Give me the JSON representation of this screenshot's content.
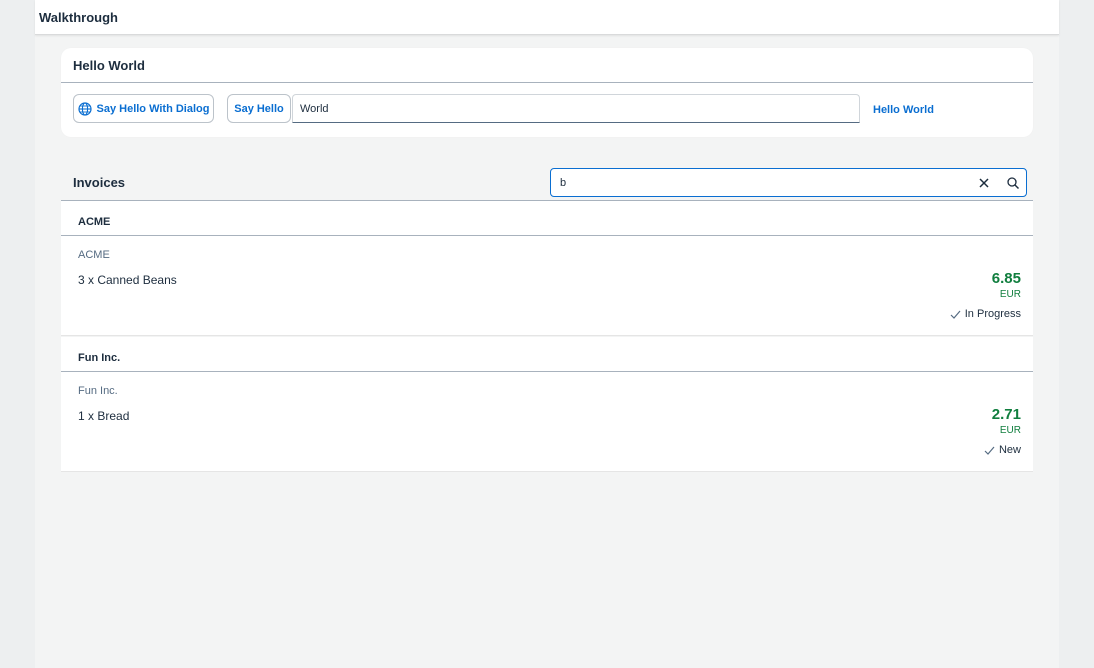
{
  "shell": {
    "title": "Walkthrough"
  },
  "hello_panel": {
    "title": "Hello World",
    "dialog_button_label": "Say Hello With Dialog",
    "hello_button_label": "Say Hello",
    "name_value": "World",
    "result_text": "Hello World"
  },
  "invoices": {
    "title": "Invoices",
    "search_value": "b",
    "groups": [
      {
        "header": "ACME",
        "items": [
          {
            "intro": "ACME",
            "title": "3 x Canned Beans",
            "number": "6.85",
            "unit": "EUR",
            "status": "In Progress"
          }
        ]
      },
      {
        "header": "Fun Inc.",
        "items": [
          {
            "intro": "Fun Inc.",
            "title": "1 x Bread",
            "number": "2.71",
            "unit": "EUR",
            "status": "New"
          }
        ]
      }
    ]
  },
  "colors": {
    "accent": "#0a6ed1",
    "positive": "#107e3e",
    "text": "#1d2d3e"
  },
  "icons": {
    "dialog_button": "globe-icon",
    "search_clear": "close-icon",
    "search_go": "search-icon",
    "status": "checkmark-icon"
  }
}
